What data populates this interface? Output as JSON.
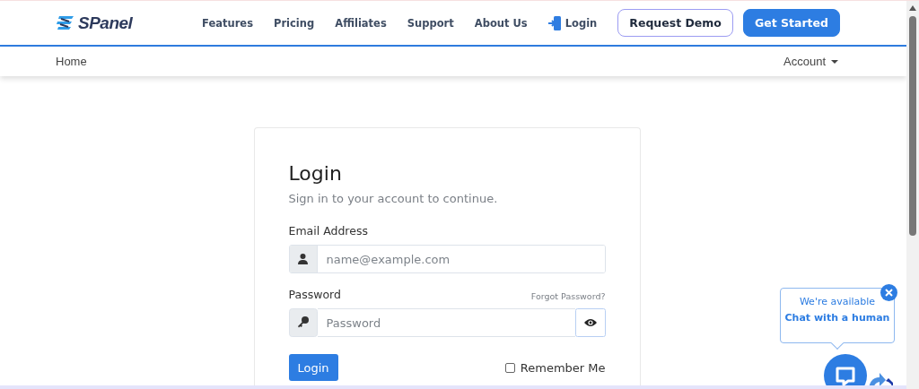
{
  "header": {
    "logo": "SPanel",
    "nav": [
      "Features",
      "Pricing",
      "Affiliates",
      "Support",
      "About Us"
    ],
    "login_link": "Login",
    "buttons": [
      {
        "label": "Request Demo",
        "kind": "outline"
      },
      {
        "label": "Get Started",
        "kind": "primary"
      }
    ]
  },
  "subnav": {
    "home": "Home",
    "account": "Account"
  },
  "login_card": {
    "title": "Login",
    "subtitle": "Sign in to your account to continue.",
    "email": {
      "label": "Email Address",
      "placeholder": "name@example.com"
    },
    "password": {
      "label": "Password",
      "placeholder": "Password",
      "forgot": "Forgot Password?"
    },
    "submit": "Login",
    "remember": {
      "label": "Remember Me",
      "checked": false
    }
  },
  "chat": {
    "line1": "We're available",
    "line2": "Chat with a human"
  }
}
